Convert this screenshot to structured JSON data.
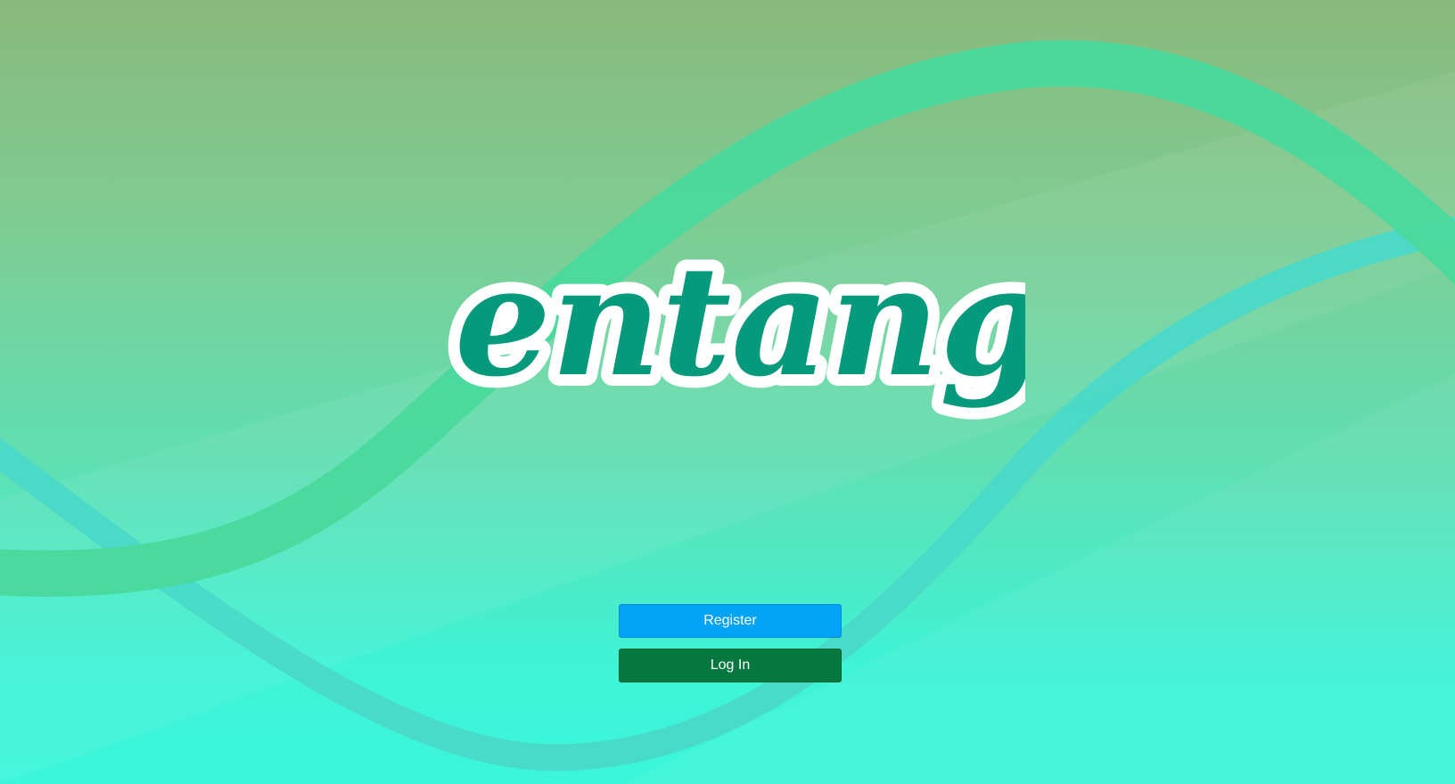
{
  "logo": {
    "text": "entangle",
    "fill_color": "#069a7c",
    "outline_color": "#ffffff"
  },
  "actions": {
    "register_label": "Register",
    "login_label": "Log In"
  },
  "colors": {
    "register_button": "#00a3f5",
    "login_button": "#04783f",
    "background_top": "#8ab97c",
    "background_bottom": "#3cf6da",
    "wave_green": "#4ad99c",
    "wave_teal": "#4ad9c8"
  }
}
